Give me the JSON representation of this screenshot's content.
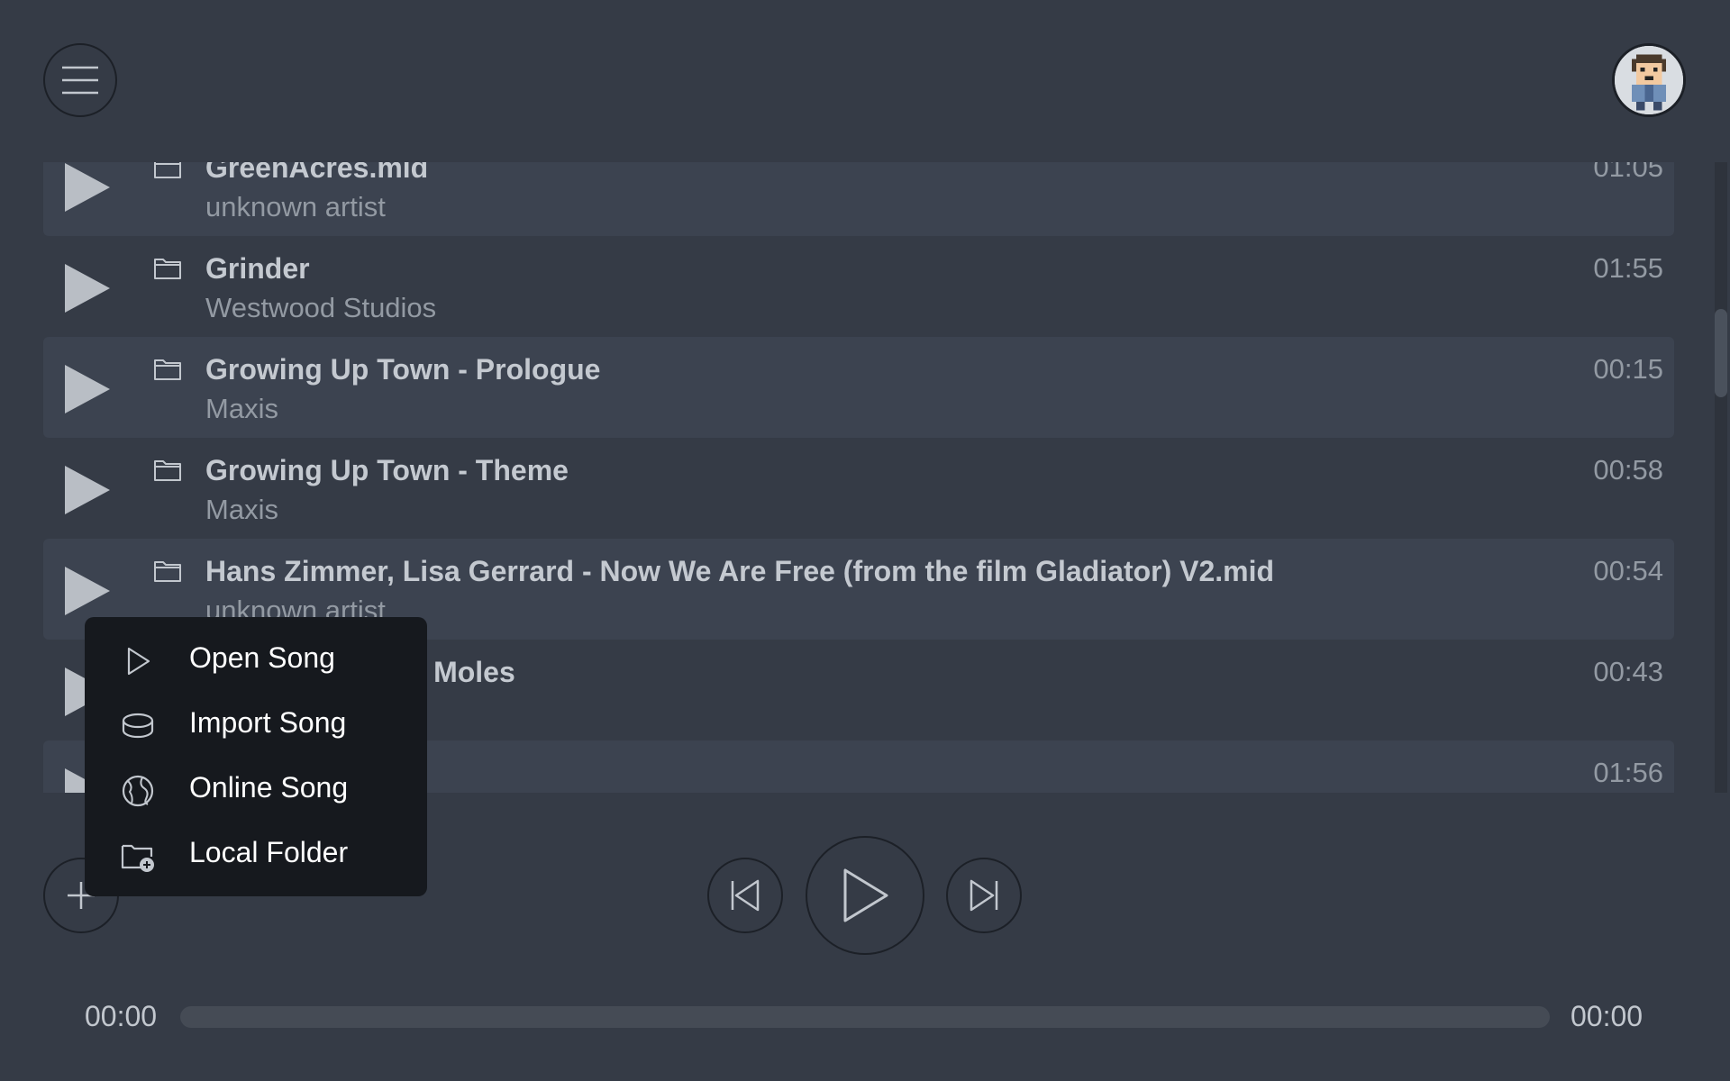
{
  "header": {
    "menu_icon": "hamburger-menu-icon",
    "avatar_icon": "pixel-avatar"
  },
  "songs": [
    {
      "title": "GreenAcres.mid",
      "artist": "unknown artist",
      "duration": "01:05"
    },
    {
      "title": "Grinder",
      "artist": "Westwood Studios",
      "duration": "01:55"
    },
    {
      "title": "Growing Up Town - Prologue",
      "artist": "Maxis",
      "duration": "00:15"
    },
    {
      "title": "Growing Up Town - Theme",
      "artist": "Maxis",
      "duration": "00:58"
    },
    {
      "title": "Hans Zimmer, Lisa Gerrard - Now We Are Free (from the film Gladiator) V2.mid",
      "artist": "unknown artist",
      "duration": "00:54"
    },
    {
      "title": "Moles Are Good Moles",
      "artist": "",
      "duration": "00:43"
    },
    {
      "title": "",
      "artist": "",
      "duration": "01:56"
    }
  ],
  "context_menu": {
    "items": [
      {
        "label": "Open Song",
        "icon": "play-outline-icon"
      },
      {
        "label": "Import Song",
        "icon": "disc-icon"
      },
      {
        "label": "Online Song",
        "icon": "globe-icon"
      },
      {
        "label": "Local Folder",
        "icon": "folder-add-icon"
      }
    ]
  },
  "player": {
    "elapsed": "00:00",
    "total": "00:00",
    "progress_fraction": 0
  },
  "colors": {
    "background": "#353b46",
    "row_alt": "#3c4350",
    "menu_bg": "#16191e",
    "play_icon": "#b9bec5"
  }
}
